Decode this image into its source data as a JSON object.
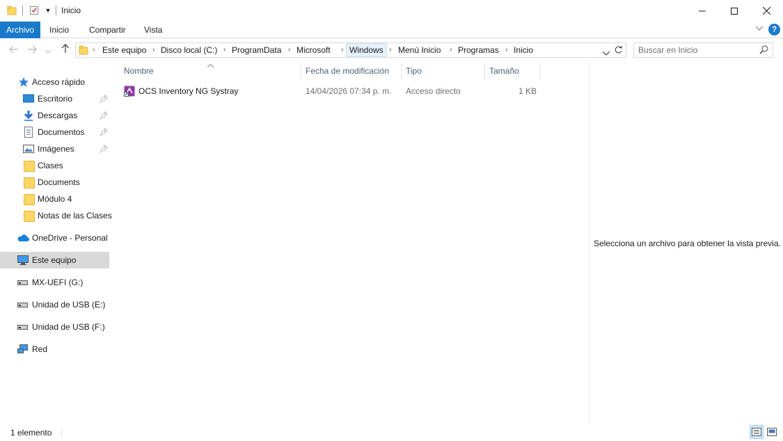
{
  "window": {
    "title": "Inicio",
    "controls": [
      "minimize",
      "maximize",
      "close"
    ]
  },
  "ribbon": {
    "tabs": [
      "Archivo",
      "Inicio",
      "Compartir",
      "Vista"
    ],
    "help_label": "?"
  },
  "address_bar": {
    "breadcrumbs": [
      "Este equipo",
      "Disco local (C:)",
      "ProgramData",
      "Microsoft",
      "Windows",
      "Menú Inicio",
      "Programas",
      "Inicio"
    ],
    "highlighted": "Windows"
  },
  "search": {
    "placeholder": "Buscar en Inicio",
    "value": ""
  },
  "sidebar": {
    "quick_access": {
      "label": "Acceso rápido",
      "items": [
        {
          "label": "Escritorio",
          "icon": "desktop-icon",
          "pinned": true
        },
        {
          "label": "Descargas",
          "icon": "download-icon",
          "pinned": true
        },
        {
          "label": "Documentos",
          "icon": "documents-icon",
          "pinned": true
        },
        {
          "label": "Imágenes",
          "icon": "pictures-icon",
          "pinned": true
        },
        {
          "label": "Clases",
          "icon": "folder-icon",
          "pinned": false
        },
        {
          "label": "Documents",
          "icon": "folder-icon",
          "pinned": false
        },
        {
          "label": "Módulo 4",
          "icon": "folder-icon",
          "pinned": false
        },
        {
          "label": "Notas de las Clases",
          "icon": "folder-icon",
          "pinned": false
        }
      ]
    },
    "onedrive": "OneDrive - Personal",
    "this_pc": "Este equipo",
    "drives": [
      "MX-UEFI (G:)",
      "Unidad de USB (E:)",
      "Unidad de USB (F:)"
    ],
    "network": "Red"
  },
  "columns": [
    "Nombre",
    "Fecha de modificación",
    "Tipo",
    "Tamaño"
  ],
  "files": [
    {
      "name": "OCS Inventory NG Systray",
      "modified": "14/04/2026 07:34 p. m.",
      "type": "Acceso directo",
      "size": "1 KB"
    }
  ],
  "preview": {
    "message": "Selecciona un archivo para obtener la vista previa."
  },
  "status": {
    "item_count": "1 elemento"
  },
  "colors": {
    "accent": "#1979ca",
    "selected_nav": "#d9d9d9",
    "header_text": "#4c607a"
  }
}
